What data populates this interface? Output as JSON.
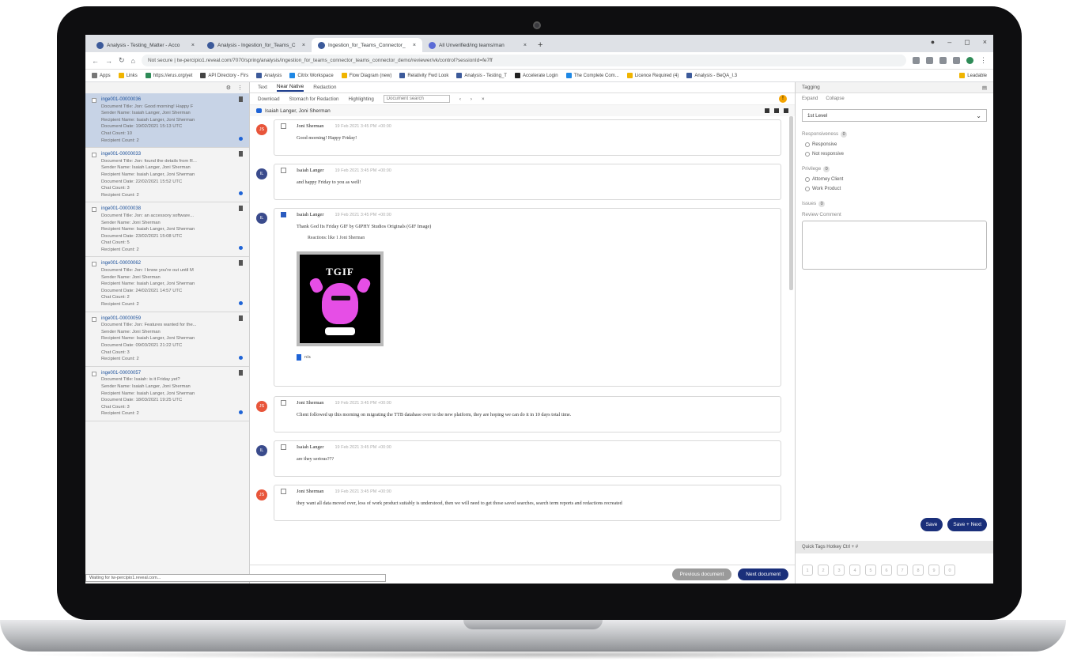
{
  "browser": {
    "tabs": [
      {
        "label": "Analysis - Testing_Matter - Acco"
      },
      {
        "label": "Analysis - Ingestion_for_Teams_C"
      },
      {
        "label": "Ingestion_for_Teams_Connector_",
        "active": true
      },
      {
        "label": "All Unverified/ing teams/man"
      }
    ],
    "new_tab": "+",
    "url": "Not secure | tw-percipio1.reveal.com/7070/spring/analysis/ingestion_for_teams_connector_teams_connector_demo/reviewer/vk/control?sessionId=fe7ff",
    "bookmarks": [
      "Apps",
      "Links",
      "https://erus.org/yet",
      "API Directory - Firs",
      "Analysis",
      "Citrix Workspace",
      "Flow Diagram (new)",
      "Relativity Fwd Look",
      "Analysis - Testing_T",
      "Accelerate Login",
      "The Complete Com...",
      "Licence Required (4)",
      "Analysis - BeQA_I.3"
    ],
    "reading_list": "Leadable"
  },
  "docs": [
    {
      "id": "inge001-00000036",
      "title": "Document Title: Jon: Good morning! Happy F",
      "sender": "Sender Name: Isaiah Langer, Joni Sherman",
      "recipient": "Recipient Name: Isaiah Langer, Joni Sherman",
      "date": "Document Date: 19/02/2021 15:13 UTC",
      "chat": "Chat Count: 10",
      "rcount": "Recipient Count: 2",
      "selected": true
    },
    {
      "id": "inge001-00000033",
      "title": "Document Title: Jon: found the details from R...",
      "sender": "Sender Name: Isaiah Langer, Joni Sherman",
      "recipient": "Recipient Name: Isaiah Langer, Joni Sherman",
      "date": "Document Date: 22/02/2021 15:52 UTC",
      "chat": "Chat Count: 3",
      "rcount": "Recipient Count: 2"
    },
    {
      "id": "inge001-00000038",
      "title": "Document Title: Jon: an accessory software...",
      "sender": "Sender Name: Joni Sherman",
      "recipient": "Recipient Name: Isaiah Langer, Joni Sherman",
      "date": "Document Date: 23/02/2021 15:08 UTC",
      "chat": "Chat Count: 5",
      "rcount": "Recipient Count: 2"
    },
    {
      "id": "inge001-00000062",
      "title": "Document Title: Jon: I know you're out until M",
      "sender": "Sender Name: Joni Sherman",
      "recipient": "Recipient Name: Isaiah Langer, Joni Sherman",
      "date": "Document Date: 24/02/2021 14:57 UTC",
      "chat": "Chat Count: 2",
      "rcount": "Recipient Count: 2"
    },
    {
      "id": "inge001-00000059",
      "title": "Document Title: Jon: Features wanted for the...",
      "sender": "Sender Name: Joni Sherman",
      "recipient": "Recipient Name: Isaiah Langer, Joni Sherman",
      "date": "Document Date: 09/03/2021 21:22 UTC",
      "chat": "Chat Count: 3",
      "rcount": "Recipient Count: 2"
    },
    {
      "id": "inge001-00000057",
      "title": "Document Title: Isaiah: is it Friday yet?",
      "sender": "Sender Name: Isaiah Langer, Joni Sherman",
      "recipient": "Recipient Name: Isaiah Langer, Joni Sherman",
      "date": "Document Date: 18/03/2021 19:25 UTC",
      "chat": "Chat Count: 3",
      "rcount": "Recipient Count: 2"
    }
  ],
  "status_line": "Waiting for tw-percipio1.reveal.com...",
  "center": {
    "tabs": [
      "Text",
      "Near Native",
      "Redaction"
    ],
    "toolbar": {
      "download": "Download",
      "redact": "Stomach for Redaction",
      "highlighting": "Highlighting",
      "search_placeholder": "Document search",
      "warning": "!"
    },
    "conversation_title": "Isaiah Langer, Joni Sherman",
    "messages": [
      {
        "initials": "JS",
        "sender": "Joni Sherman",
        "time": "19 Feb 2021 3:45 PM +00:00",
        "text": "Good morning! Happy Friday!",
        "color": "#e8553a"
      },
      {
        "initials": "IL",
        "sender": "Isaiah Langer",
        "time": "19 Feb 2021 3:45 PM +00:00",
        "text": "and happy Friday to you as well!",
        "color": "#3a4b8c"
      },
      {
        "initials": "IL",
        "sender": "Isaiah Langer",
        "time": "19 Feb 2021 3:45 PM +00:00",
        "text": "Thank God Its Friday GIF by GIPHY Studios Originals (GIF Image)",
        "subtext": "Reactions:  like  1    Joni Sherman",
        "gif_text": "TGIF",
        "attachment": "n/a",
        "color": "#3a4b8c"
      },
      {
        "initials": "JS",
        "sender": "Joni Sherman",
        "time": "19 Feb 2021 3:45 PM +00:00",
        "text": "Client followed up this morning on migrating the TTB database over to the new platform, they are hoping we can do it in 10 days total time.",
        "color": "#e8553a"
      },
      {
        "initials": "IL",
        "sender": "Isaiah Langer",
        "time": "19 Feb 2021 3:45 PM +00:00",
        "text": "are they serious???",
        "color": "#3a4b8c"
      },
      {
        "initials": "JS",
        "sender": "Joni Sherman",
        "time": "19 Feb 2021 3:45 PM +00:00",
        "text": "they want all data moved over, loss of work product suitably is understood, then we will need to get those saved searches, search term reports and redactions recreated",
        "color": "#e8553a"
      }
    ],
    "prev_label": "Previous document",
    "next_label": "Next document"
  },
  "right": {
    "title": "Tagging",
    "expand": "Expand",
    "collapse": "Collapse",
    "level": "1st Level",
    "responsiveness": {
      "label": "Responsiveness",
      "count": "0",
      "options": [
        "Responsive",
        "Not responsive"
      ]
    },
    "privilege": {
      "label": "Privilege",
      "count": "0",
      "options": [
        "Attorney Client",
        "Work Product"
      ]
    },
    "issues": {
      "label": "Issues",
      "count": "0"
    },
    "comment_label": "Review Comment",
    "save": "Save",
    "save_next": "Save + Next",
    "quick_tags": "Quick Tags Hotkey Ctrl + #",
    "keys": [
      "1",
      "2",
      "3",
      "4",
      "5",
      "6",
      "7",
      "8",
      "9",
      "0"
    ]
  }
}
